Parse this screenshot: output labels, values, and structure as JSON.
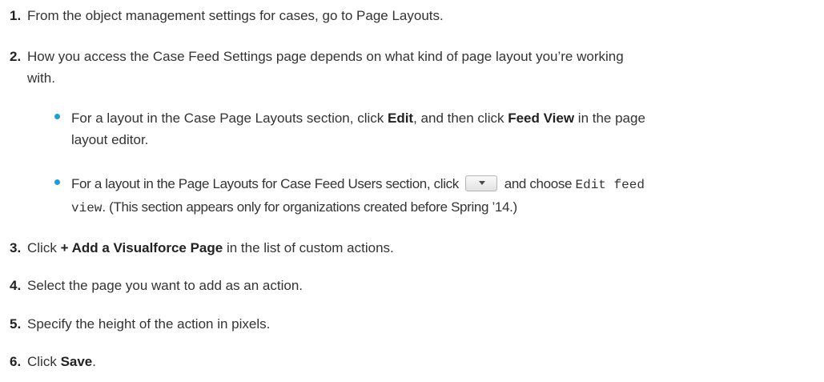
{
  "steps": [
    {
      "number": "1.",
      "text": "From the object management settings for cases, go to Page Layouts."
    },
    {
      "number": "2.",
      "line1": "How you access the Case Feed Settings page depends on what kind of page layout you’re working",
      "line2": "with."
    },
    {
      "number": "3.",
      "pre": "Click ",
      "bold": "+ Add a Visualforce Page",
      "post": " in the list of custom actions."
    },
    {
      "number": "4.",
      "text": "Select the page you want to add as an action."
    },
    {
      "number": "5.",
      "text": "Specify the height of the action in pixels."
    },
    {
      "number": "6.",
      "pre": "Click ",
      "bold": "Save",
      "post": "."
    }
  ],
  "bullets": [
    {
      "pre": "For a layout in the Case Page Layouts section, click ",
      "bold1": "Edit",
      "mid": ", and then click ",
      "bold2": "Feed View",
      "post": " in the page",
      "line2": "layout editor."
    },
    {
      "pre": "For a layout in the Page Layouts for Case Feed Users section, click ",
      "mid": " and choose ",
      "code1": "Edit feed",
      "code2": "view",
      "post": ". (This section appears only for organizations created before Spring ’14.)"
    }
  ],
  "icons": {
    "bullet_color": "#1aa0d9",
    "dropdown_icon": "chevron-down-icon"
  }
}
